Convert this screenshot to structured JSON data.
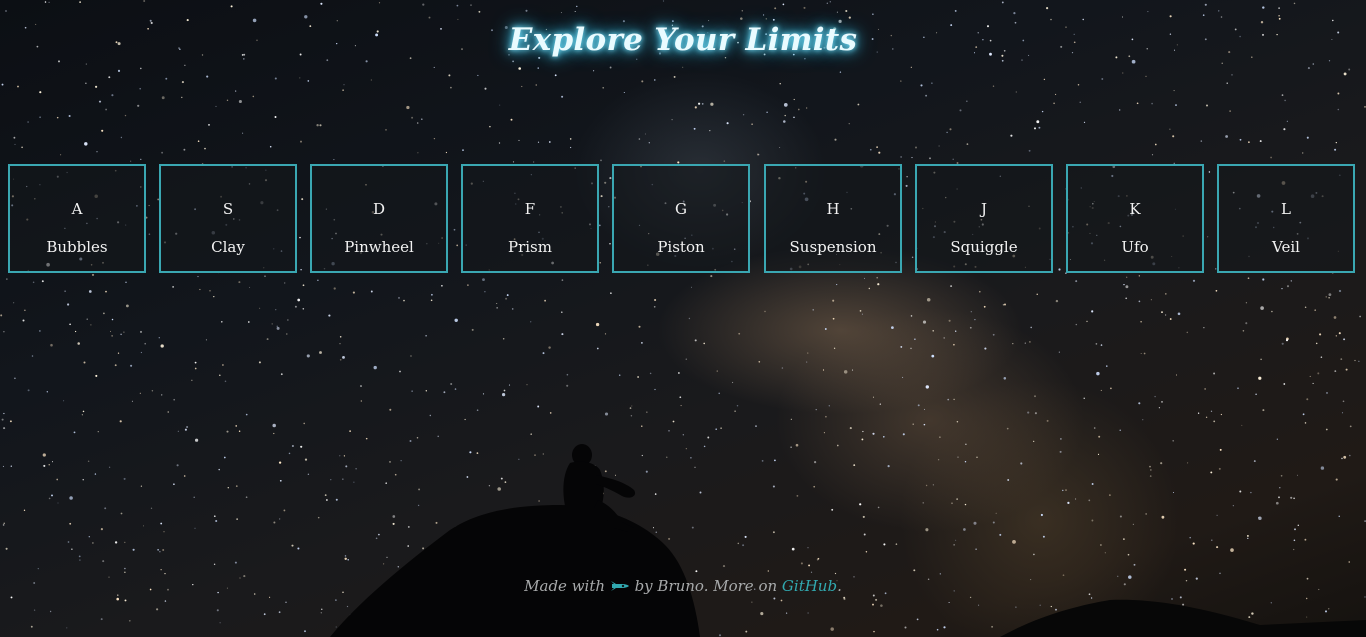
{
  "page": {
    "title": "Explore Your Limits"
  },
  "keys": [
    {
      "letter": "A",
      "label": "Bubbles"
    },
    {
      "letter": "S",
      "label": "Clay"
    },
    {
      "letter": "D",
      "label": "Pinwheel"
    },
    {
      "letter": "F",
      "label": "Prism"
    },
    {
      "letter": "G",
      "label": "Piston"
    },
    {
      "letter": "H",
      "label": "Suspension"
    },
    {
      "letter": "J",
      "label": "Squiggle"
    },
    {
      "letter": "K",
      "label": "Ufo"
    },
    {
      "letter": "L",
      "label": "Veil"
    }
  ],
  "footer": {
    "made_with": "Made with",
    "icon": "rocket-icon",
    "by": "by Bruno. More on",
    "link_text": "GitHub",
    "period": "."
  },
  "colors": {
    "accent": "#3aa7b2",
    "title_glow": "#3fc9ee",
    "link": "#31a9b0"
  }
}
